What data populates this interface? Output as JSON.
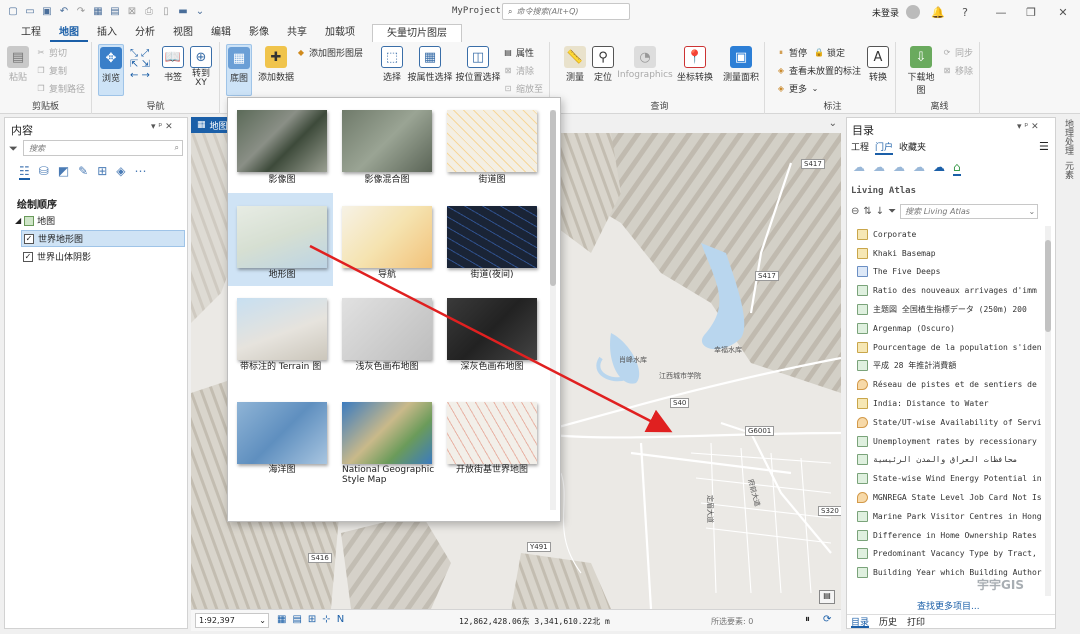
{
  "titlebar": {
    "project": "MyProject",
    "command_search_placeholder": "命令搜索(Alt+Q)",
    "login": "未登录"
  },
  "tabs": [
    "工程",
    "地图",
    "插入",
    "分析",
    "视图",
    "编辑",
    "影像",
    "共享",
    "加载项"
  ],
  "context_tab": "矢量切片图层",
  "active_tab": "地图",
  "ribbon": {
    "clipboard": {
      "paste": "粘贴",
      "cut": "剪切",
      "copy": "复制",
      "copy_path": "复制路径",
      "label": "剪贴板"
    },
    "navigate": {
      "explore": "浏览",
      "bookmarks": "书签",
      "goto": "转到\nXY",
      "label": "导航"
    },
    "layer": {
      "basemap": "底图",
      "add_data": "添加数据",
      "add_graphics": "添加图形图层"
    },
    "selection": {
      "select": "选择",
      "by_attr": "按属性选择",
      "by_loc": "按位置选择",
      "attributes": "属性",
      "clear": "清除",
      "zoom_to": "缩放至"
    },
    "inquiry": {
      "measure": "测量",
      "locate": "定位",
      "infographics": "Infographics",
      "coord": "坐标转换",
      "measure_area": "测量面积",
      "label": "查询"
    },
    "labeling": {
      "pause": "暂停",
      "lock": "锁定",
      "view_unplaced": "查看未放置的标注",
      "more": "更多",
      "convert": "转换",
      "label": "标注"
    },
    "offline": {
      "download": "下载地图",
      "sync": "同步",
      "remove": "移除",
      "label": "离线"
    }
  },
  "contents": {
    "title": "内容",
    "search_placeholder": "搜索",
    "drawing_order": "绘制顺序",
    "map": "地图",
    "layers": [
      "世界地形图",
      "世界山体阴影"
    ]
  },
  "map_tab": "地图",
  "basemaps": [
    {
      "label": "影像图"
    },
    {
      "label": "影像混合图"
    },
    {
      "label": "街道图"
    },
    {
      "label": "地形图"
    },
    {
      "label": "导航"
    },
    {
      "label": "街道(夜间)"
    },
    {
      "label": "带标注的 Terrain 图"
    },
    {
      "label": "浅灰色画布地图"
    },
    {
      "label": "深灰色画布地图"
    },
    {
      "label": "海洋图"
    },
    {
      "label": "National Geographic Style Map"
    },
    {
      "label": "开放街基世界地图"
    }
  ],
  "selected_basemap": "地形图",
  "map_labels": {
    "reservoir1": "肖峰水库",
    "reservoir2": "幸福水库",
    "school": "江西城市学院",
    "road1": "S417",
    "road2": "S417",
    "road3": "S40",
    "road4": "G6001",
    "road5": "S320",
    "road6": "S416",
    "road7": "Y491",
    "ave1": "定眉大道",
    "ave2": "府前大道"
  },
  "status": {
    "scale": "1:92,397",
    "coords": "12,862,428.06东  3,341,610.22北 m",
    "selected": "所选要素: 0"
  },
  "catalog": {
    "title": "目录",
    "tabs": [
      "工程",
      "门户",
      "收藏夹"
    ],
    "active_tab": "门户",
    "section": "Living Atlas",
    "search_placeholder": "搜索 Living Atlas",
    "items": [
      {
        "name": "Corporate",
        "kind": "y"
      },
      {
        "name": "Khaki Basemap",
        "kind": "y"
      },
      {
        "name": "The Five Deeps",
        "kind": "b"
      },
      {
        "name": "Ratio des nouveaux arrivages d'imm",
        "kind": "g"
      },
      {
        "name": "主题図 全国植生指標データ (250m) 200",
        "kind": "g"
      },
      {
        "name": "Argenmap (Oscuro)",
        "kind": "g"
      },
      {
        "name": "Pourcentage de la population s'iden",
        "kind": "y"
      },
      {
        "name": "平成 28 年推計消費額",
        "kind": "g"
      },
      {
        "name": "Réseau de pistes et de sentiers de",
        "kind": "p"
      },
      {
        "name": "India: Distance to Water",
        "kind": "y"
      },
      {
        "name": "State/UT-wise Availability of Servi",
        "kind": "p"
      },
      {
        "name": "Unemployment rates by recessionary",
        "kind": "g"
      },
      {
        "name": "محافظات العراق والمدن الرئيسية",
        "kind": "g"
      },
      {
        "name": "State-wise Wind Energy Potential in",
        "kind": "g"
      },
      {
        "name": "MGNREGA State Level Job Card Not Is",
        "kind": "p"
      },
      {
        "name": "Marine Park Visitor Centres in Hong",
        "kind": "g"
      },
      {
        "name": "Difference in Home Ownership Rates",
        "kind": "g"
      },
      {
        "name": "Predominant Vacancy Type by Tract,",
        "kind": "g"
      },
      {
        "name": "Building Year which Building Author",
        "kind": "g"
      }
    ],
    "find_more": "查找更多项目...",
    "bottom_tabs": [
      "目录",
      "历史",
      "打印"
    ]
  },
  "side_vtabs": [
    "地理处理",
    "元素"
  ],
  "watermark": "宇宇GIS"
}
